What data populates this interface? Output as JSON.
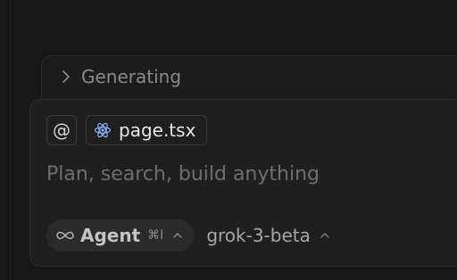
{
  "generating": {
    "label": "Generating"
  },
  "composer": {
    "at_symbol": "@",
    "file_chip": {
      "name": "page.tsx",
      "icon": "react-icon"
    },
    "input": {
      "placeholder": "Plan, search, build anything",
      "value": ""
    },
    "mode": {
      "icon": "infinity-icon",
      "label": "Agent",
      "shortcut": "⌘I"
    },
    "model": {
      "label": "grok-3-beta"
    }
  },
  "colors": {
    "background": "#181818",
    "panel": "#1f1f1f",
    "border": "#2e2e2e",
    "react_icon": "#8ab4f8"
  }
}
